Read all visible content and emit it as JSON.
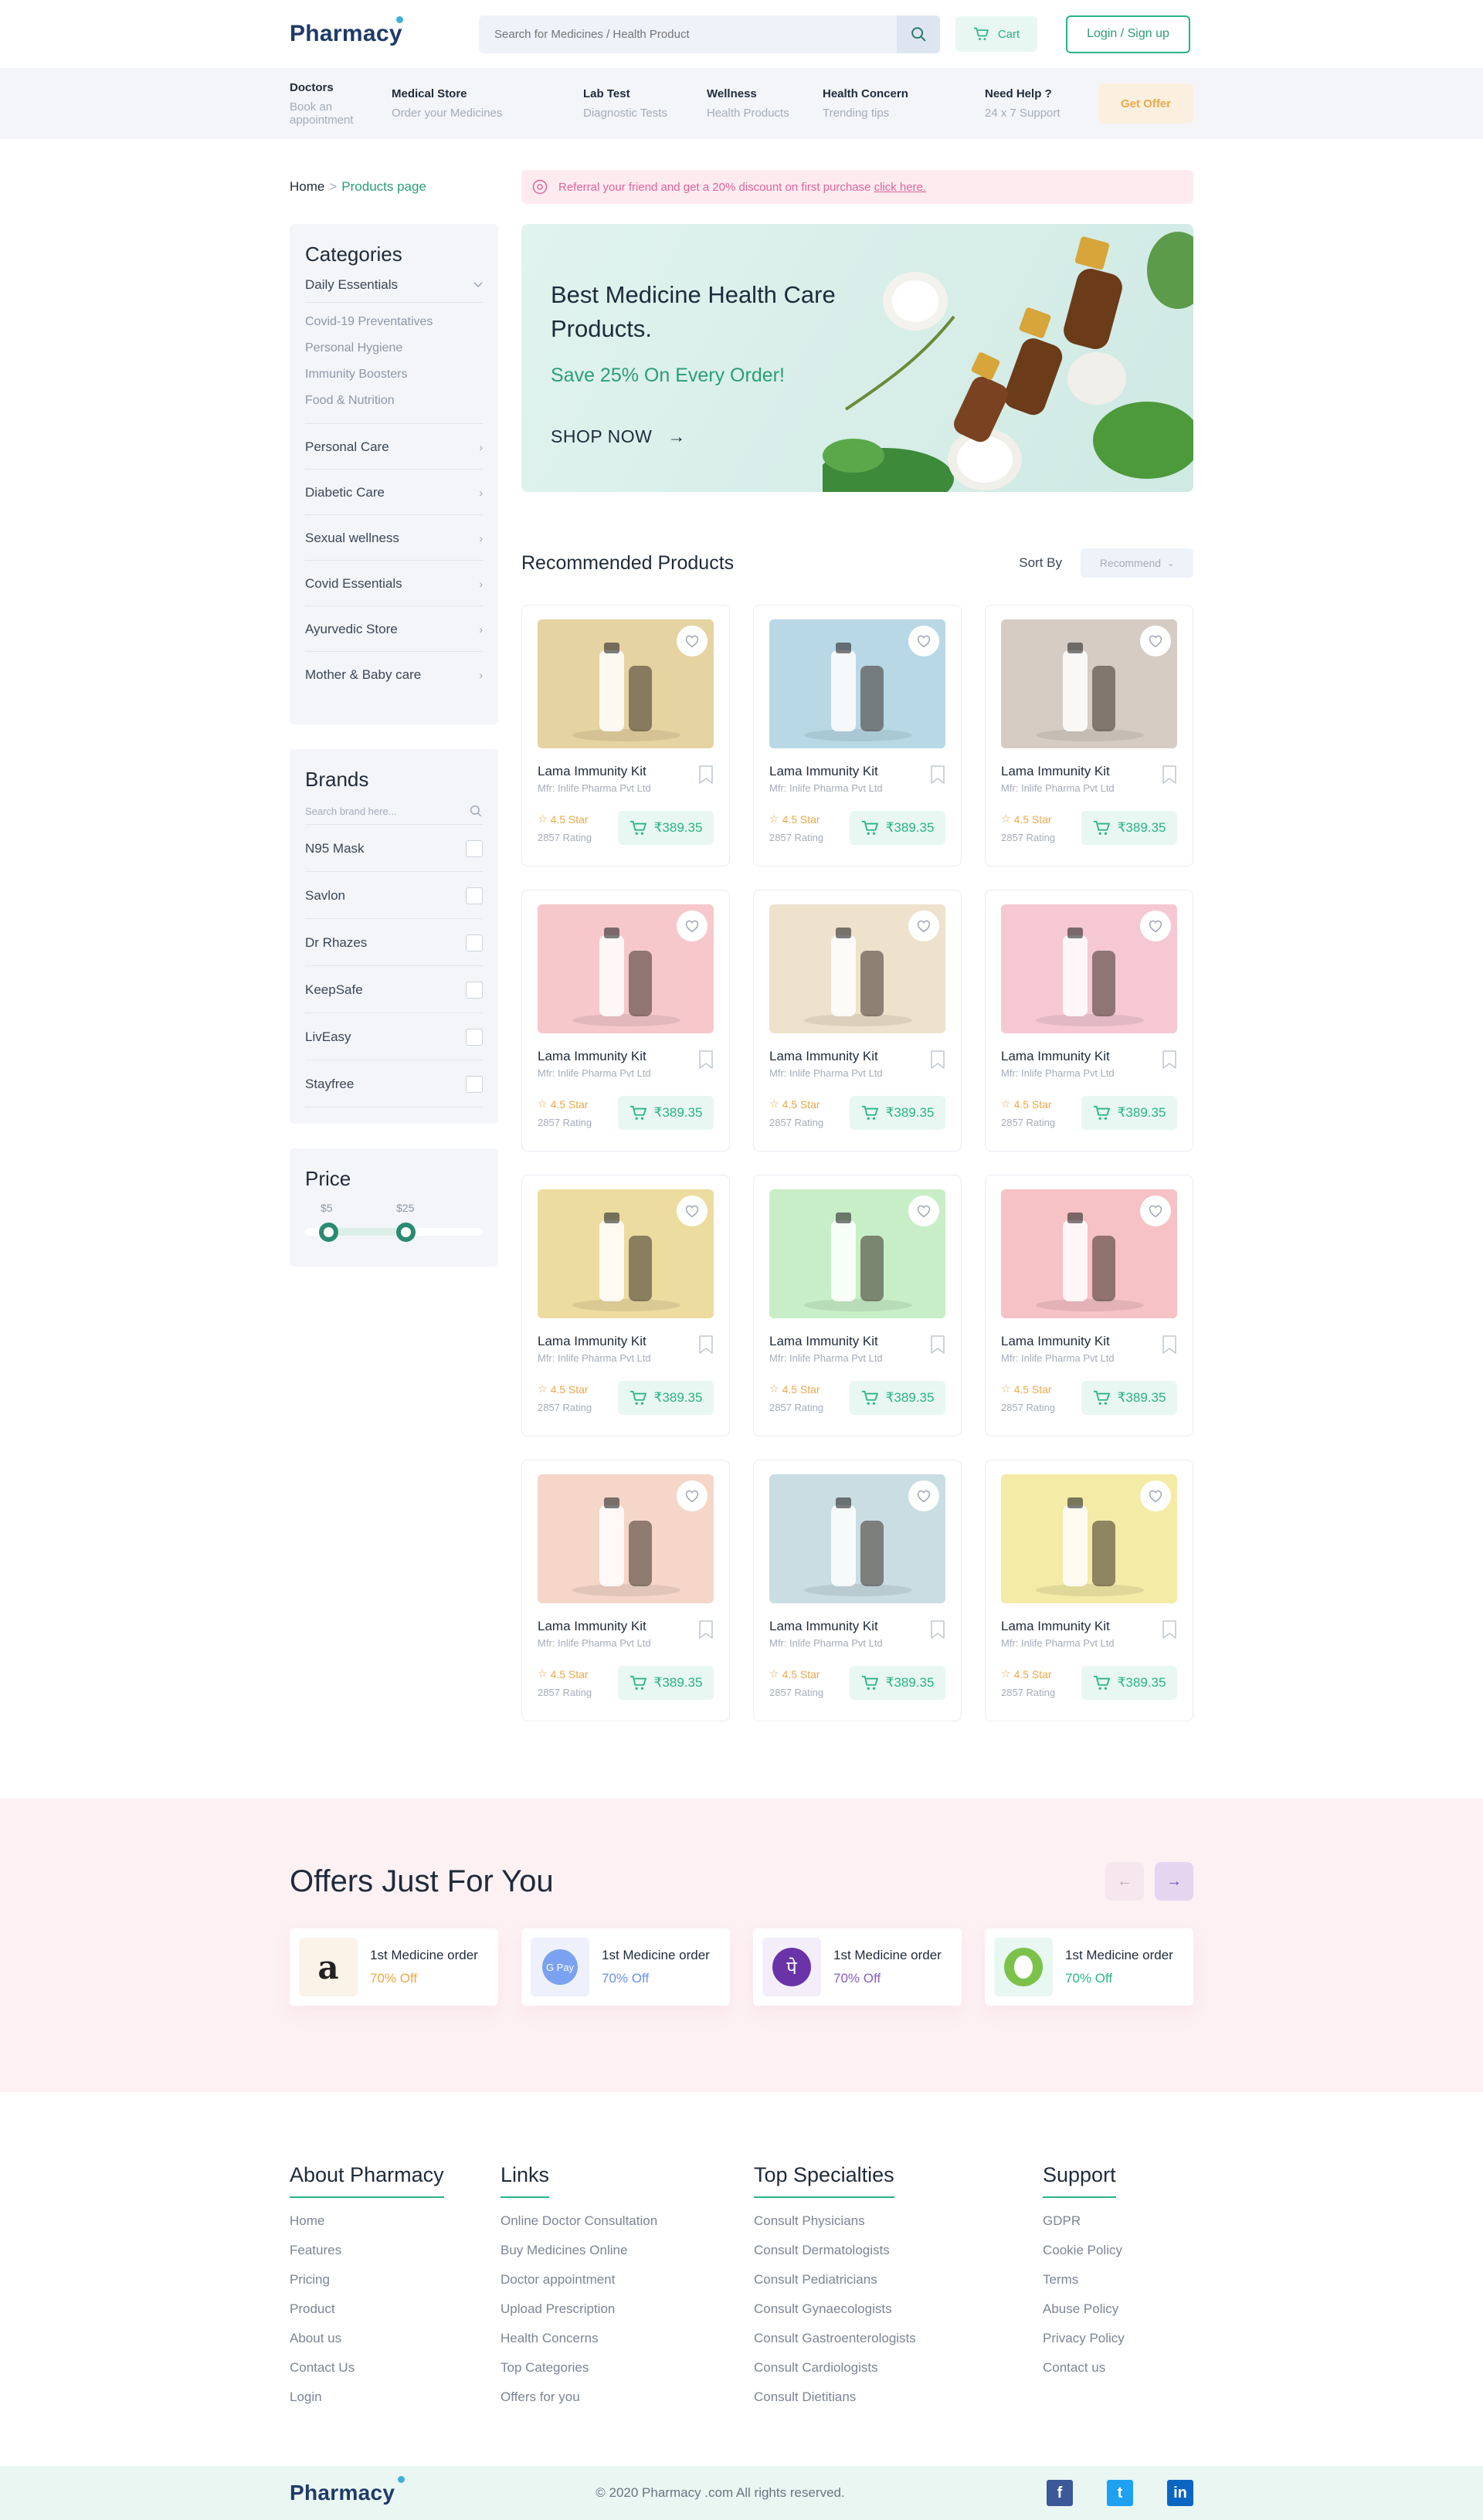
{
  "header": {
    "logo": "Pharmacy",
    "search_placeholder": "Search for Medicines / Health Product",
    "cart_label": "Cart",
    "login_label": "Login / Sign up"
  },
  "subnav": {
    "items": [
      {
        "title": "Doctors",
        "sub": "Book an appointment"
      },
      {
        "title": "Medical Store",
        "sub": "Order your Medicines"
      },
      {
        "title": "Lab Test",
        "sub": "Diagnostic Tests"
      },
      {
        "title": "Wellness",
        "sub": "Health Products"
      },
      {
        "title": "Health Concern",
        "sub": "Trending tips"
      },
      {
        "title": "Need Help ?",
        "sub": "24 x 7 Support"
      }
    ],
    "offer_button": "Get Offer"
  },
  "breadcrumb": {
    "home": "Home",
    "separator": ">",
    "current": "Products page"
  },
  "referral": {
    "text": "Referral your friend and get a 20% discount on first purchase",
    "link": "click here."
  },
  "categories": {
    "title": "Categories",
    "open": "Daily Essentials",
    "subitems": [
      "Covid-19 Preventatives",
      "Personal Hygiene",
      "Immunity Boosters",
      "Food & Nutrition"
    ],
    "items": [
      "Personal Care",
      "Diabetic Care",
      "Sexual wellness",
      "Covid Essentials",
      "Ayurvedic Store",
      "Mother & Baby care"
    ]
  },
  "brands": {
    "title": "Brands",
    "search_placeholder": "Search brand here...",
    "items": [
      "N95 Mask",
      "Savlon",
      "Dr Rhazes",
      "KeepSafe",
      "LivEasy",
      "Stayfree"
    ]
  },
  "price": {
    "title": "Price",
    "min_label": "$5",
    "max_label": "$25"
  },
  "banner": {
    "title": "Best Medicine Health Care Products.",
    "subtitle": "Save 25% On Every Order!",
    "cta": "SHOP NOW"
  },
  "recommended": {
    "title": "Recommended Products",
    "sort_label": "Sort By",
    "sort_value": "Recommend",
    "products": [
      {
        "name": "Lama Immunity Kit",
        "mfr": "Mfr: Inlife Pharma Pvt Ltd",
        "rating": "4.5 Star",
        "count": "2857 Rating",
        "price": "₹389.35",
        "bg": "#e6d3a2"
      },
      {
        "name": "Lama Immunity Kit",
        "mfr": "Mfr: Inlife Pharma Pvt Ltd",
        "rating": "4.5 Star",
        "count": "2857 Rating",
        "price": "₹389.35",
        "bg": "#b9d8e6"
      },
      {
        "name": "Lama Immunity Kit",
        "mfr": "Mfr: Inlife Pharma Pvt Ltd",
        "rating": "4.5 Star",
        "count": "2857 Rating",
        "price": "₹389.35",
        "bg": "#d6ccc4"
      },
      {
        "name": "Lama Immunity Kit",
        "mfr": "Mfr: Inlife Pharma Pvt Ltd",
        "rating": "4.5 Star",
        "count": "2857 Rating",
        "price": "₹389.35",
        "bg": "#f6c8cc"
      },
      {
        "name": "Lama Immunity Kit",
        "mfr": "Mfr: Inlife Pharma Pvt Ltd",
        "rating": "4.5 Star",
        "count": "2857 Rating",
        "price": "₹389.35",
        "bg": "#eee2cc"
      },
      {
        "name": "Lama Immunity Kit",
        "mfr": "Mfr: Inlife Pharma Pvt Ltd",
        "rating": "4.5 Star",
        "count": "2857 Rating",
        "price": "₹389.35",
        "bg": "#f5c8d4"
      },
      {
        "name": "Lama Immunity Kit",
        "mfr": "Mfr: Inlife Pharma Pvt Ltd",
        "rating": "4.5 Star",
        "count": "2857 Rating",
        "price": "₹389.35",
        "bg": "#ecdca0"
      },
      {
        "name": "Lama Immunity Kit",
        "mfr": "Mfr: Inlife Pharma Pvt Ltd",
        "rating": "4.5 Star",
        "count": "2857 Rating",
        "price": "₹389.35",
        "bg": "#c8eec8"
      },
      {
        "name": "Lama Immunity Kit",
        "mfr": "Mfr: Inlife Pharma Pvt Ltd",
        "rating": "4.5 Star",
        "count": "2857 Rating",
        "price": "₹389.35",
        "bg": "#f6c2c6"
      },
      {
        "name": "Lama Immunity Kit",
        "mfr": "Mfr: Inlife Pharma Pvt Ltd",
        "rating": "4.5 Star",
        "count": "2857 Rating",
        "price": "₹389.35",
        "bg": "#f5d6c8"
      },
      {
        "name": "Lama Immunity Kit",
        "mfr": "Mfr: Inlife Pharma Pvt Ltd",
        "rating": "4.5 Star",
        "count": "2857 Rating",
        "price": "₹389.35",
        "bg": "#c9dde3"
      },
      {
        "name": "Lama Immunity Kit",
        "mfr": "Mfr: Inlife Pharma Pvt Ltd",
        "rating": "4.5 Star",
        "count": "2857 Rating",
        "price": "₹389.35",
        "bg": "#f3eba6"
      }
    ]
  },
  "offers": {
    "title": "Offers Just For You",
    "prev": "←",
    "next": "→",
    "items": [
      {
        "logo": "a",
        "title": "1st Medicine order",
        "off": "70% Off",
        "color": "#eba84a",
        "logo_bg": "#fbf3e8"
      },
      {
        "logo": "G Pay",
        "title": "1st Medicine order",
        "off": "70% Off",
        "color": "#6b8ff0",
        "logo_bg": "#eef1fb"
      },
      {
        "logo": "पे",
        "title": "1st Medicine order",
        "off": "70% Off",
        "color": "#8a5cc4",
        "logo_bg": "#f3eefa"
      },
      {
        "logo": "",
        "title": "1st Medicine order",
        "off": "70% Off",
        "color": "#2bb384",
        "logo_bg": "#e8f7f1"
      }
    ]
  },
  "footer": {
    "cols": [
      {
        "title": "About Pharmacy",
        "links": [
          "Home",
          "Features",
          "Pricing",
          "Product",
          "About us",
          "Contact Us",
          "Login"
        ]
      },
      {
        "title": "Links",
        "links": [
          "Online Doctor Consultation",
          "Buy Medicines Online",
          "Doctor appointment",
          "Upload Prescription",
          "Health Concerns",
          "Top Categories",
          "Offers for you"
        ]
      },
      {
        "title": "Top Specialties",
        "links": [
          "Consult Physicians",
          "Consult Dermatologists",
          "Consult Pediatricians",
          "Consult Gynaecologists",
          "Consult Gastroenterologists",
          "Consult Cardiologists",
          "Consult Dietitians"
        ]
      },
      {
        "title": "Support",
        "links": [
          "GDPR",
          "Cookie Policy",
          "Terms",
          "Abuse Policy",
          "Privacy Policy",
          "Contact us"
        ]
      }
    ],
    "logo": "Pharmacy",
    "copyright": "© 2020 Pharmacy .com All rights reserved.",
    "socials": [
      {
        "icon": "facebook-icon",
        "glyph": "f",
        "color": "#3b5998"
      },
      {
        "icon": "twitter-icon",
        "glyph": "t",
        "color": "#1da1f2"
      },
      {
        "icon": "linkedin-icon",
        "glyph": "in",
        "color": "#0a66c2"
      }
    ]
  }
}
